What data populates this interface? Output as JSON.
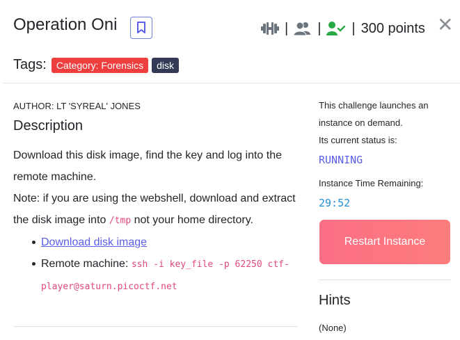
{
  "challenge": {
    "title": "Operation Oni",
    "points": "300 points",
    "separators": [
      "|",
      "|",
      "|"
    ],
    "tags_label": "Tags:",
    "tags": [
      {
        "label": "Category: Forensics",
        "color": "#ef3e3e"
      },
      {
        "label": "disk",
        "color": "#343a55"
      }
    ],
    "icons": [
      "bookmark-icon",
      "dumbbell-icon",
      "users-icon",
      "user-check-icon",
      "close-icon"
    ],
    "close_glyph": "✕"
  },
  "description": {
    "author": "AUTHOR: LT 'SYREAL' JONES",
    "heading": "Description",
    "line1": "Download this disk image, find the key and log into the remote machine.",
    "note_before": "Note: if you are using the webshell, download and extract the disk image into ",
    "note_code": "/tmp",
    "note_after": " not your home directory.",
    "download_link": "Download disk image",
    "remote_label": "Remote machine: ",
    "remote_code": "ssh -i key_file -p 62250 ctf-player@saturn.picoctf.net"
  },
  "instance": {
    "intro": "This challenge launches an instance on demand.",
    "status_label": "Its current status is:",
    "status": "RUNNING",
    "time_label": "Instance Time Remaining:",
    "time": "29:52",
    "restart_label": "Restart Instance"
  },
  "hints": {
    "heading": "Hints",
    "empty": "(None)"
  },
  "colors": {
    "accent": "#5a5ee8",
    "danger": "#ef3e3e",
    "button_gradient_start": "#fb6f86",
    "button_gradient_end": "#fd7c7c",
    "solved_green": "#28a745",
    "icon_gray": "#6c757d"
  }
}
